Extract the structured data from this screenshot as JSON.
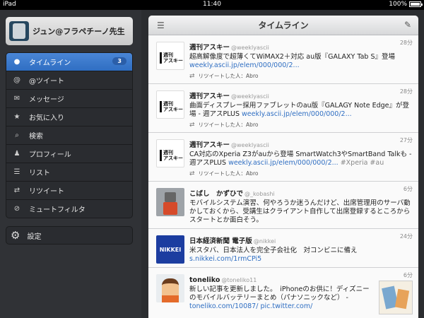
{
  "status": {
    "left": "iPad",
    "time": "11:40",
    "battery": "100%"
  },
  "account": {
    "name": "ジュン@フラペチーノ先生"
  },
  "menu": [
    {
      "label": "タイムライン",
      "icon": "speech-bubble-icon",
      "glyph": "●",
      "badge": "3",
      "active": true
    },
    {
      "label": "@ツイート",
      "icon": "at-icon",
      "glyph": "@"
    },
    {
      "label": "メッセージ",
      "icon": "envelope-icon",
      "glyph": "✉"
    },
    {
      "label": "お気に入り",
      "icon": "star-icon",
      "glyph": "★"
    },
    {
      "label": "検索",
      "icon": "search-icon",
      "glyph": "⌕"
    },
    {
      "label": "プロフィール",
      "icon": "person-icon",
      "glyph": "♟"
    },
    {
      "label": "リスト",
      "icon": "list-icon",
      "glyph": "☰"
    },
    {
      "label": "リツイート",
      "icon": "retweet-icon",
      "glyph": "⇄"
    },
    {
      "label": "ミュートフィルタ",
      "icon": "mute-icon",
      "glyph": "⊘"
    }
  ],
  "settings": {
    "label": "設定",
    "icon": "gear-icon",
    "glyph": "⚙"
  },
  "header": {
    "title": "タイムライン",
    "left_icon": "list-icon",
    "right_icon": "compose-icon"
  },
  "tweets": [
    {
      "avatar": "ascii",
      "avatar_text": "週刊\nアスキー",
      "name": "週刊アスキー",
      "handle": "@weeklyascii",
      "time": "28分",
      "text": "超高解像度で超薄くてWiMAX2＋対応 au版『GALAXY Tab S』登場 ",
      "link": "weekly.ascii.jp/elem/000/000/2...",
      "rt": "リツイートした人：Abro"
    },
    {
      "avatar": "ascii",
      "avatar_text": "週刊\nアスキー",
      "name": "週刊アスキー",
      "handle": "@weeklyascii",
      "time": "28分",
      "text": "曲面ディスプレー採用ファブレットのau版『GALAGY Note Edge』が登場 - 週アスPLUS ",
      "link": "weekly.ascii.jp/elem/000/000/2...",
      "rt": "リツイートした人：Abro"
    },
    {
      "avatar": "ascii",
      "avatar_text": "週刊\nアスキー",
      "name": "週刊アスキー",
      "handle": "@weeklyascii",
      "time": "27分",
      "text": "CA対応のXperia Z3がauから登場 SmartWatch3やSmartBand Talkも - 週アスPLUS ",
      "link": "weekly.ascii.jp/elem/000/000/2...",
      "tag": " #Xperia #au",
      "rt": "リツイートした人：Abro"
    },
    {
      "avatar": "robot",
      "name": "こばし　かずひで",
      "handle": "@_kobashi",
      "time": "6分",
      "text": "モバイルシステム演習、何やろうか迷うんだけど、出席管理用のサーバ動かしておくから、受講生はクライアント自作して出席登録するところからスタートとか面白そう。"
    },
    {
      "avatar": "nikkei",
      "avatar_text": "NIKKEI",
      "name": "日本経済新聞 電子版",
      "handle": "@nikkei",
      "time": "24分",
      "text": "米スタバ、日本法人を完全子会社化　対コンビニに備え ",
      "link": "s.nikkei.com/1rmCPi5"
    },
    {
      "avatar": "toon",
      "name": "toneliko",
      "handle": "@toneliko11",
      "time": "6分",
      "text": "新しい記事を更新しました。　iPhoneのお供に！ディズニーのモバイルバッテリーまとめ（パナソニックなど） - ",
      "link": "toneliko.com/10087/ pic.twitter.com/",
      "thumb": true
    }
  ]
}
